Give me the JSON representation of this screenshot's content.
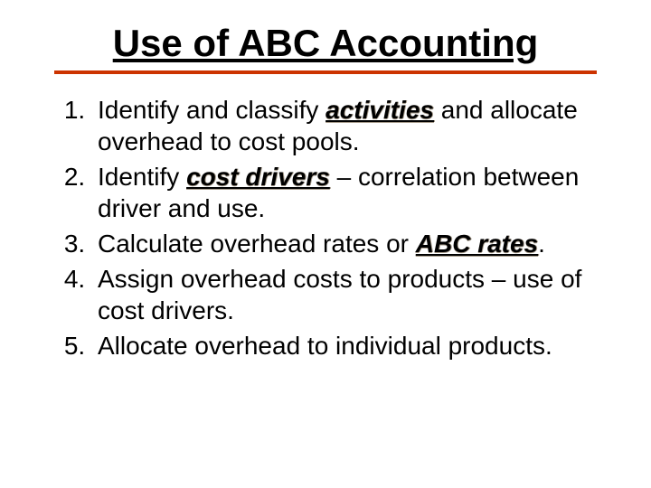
{
  "title": "Use of ABC Accounting",
  "items": [
    {
      "num": "1.",
      "pre": "Identify and classify ",
      "kw": "activities",
      "post": " and allocate overhead to cost pools."
    },
    {
      "num": "2.",
      "pre": "Identify ",
      "kw": "cost drivers",
      "post": " – correlation between driver and use."
    },
    {
      "num": "3.",
      "pre": "Calculate overhead rates or ",
      "kw": "ABC rates",
      "post": "."
    },
    {
      "num": "4.",
      "pre": "Assign overhead costs to products – use of cost drivers.",
      "kw": "",
      "post": ""
    },
    {
      "num": "5.",
      "pre": "Allocate overhead to individual products.",
      "kw": "",
      "post": ""
    }
  ]
}
